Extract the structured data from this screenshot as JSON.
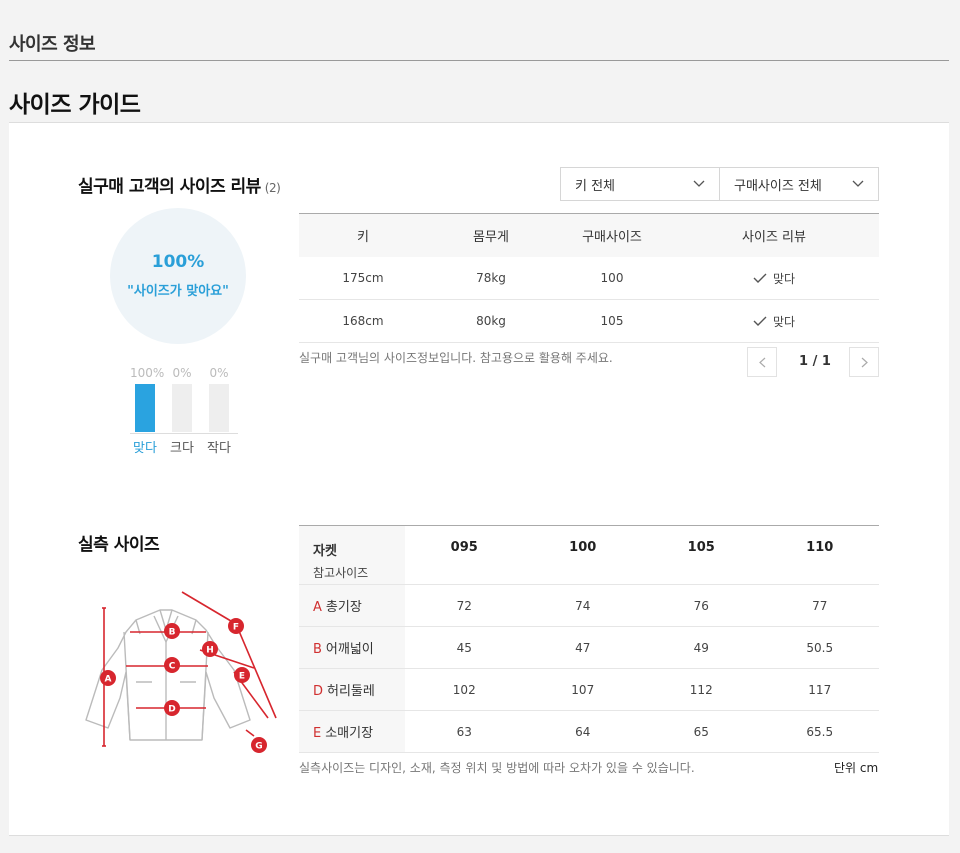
{
  "header": {
    "title": "사이즈 정보",
    "guide_title": "사이즈 가이드"
  },
  "review": {
    "title": "실구매 고객의 사이즈 리뷰",
    "count": "(2)",
    "filters": {
      "height": "키 전체",
      "size": "구매사이즈 전체"
    },
    "summary": {
      "percent": "100%",
      "text": "\"사이즈가 맞아요\""
    },
    "bars": [
      {
        "pct": "100%",
        "label": "맞다",
        "value": 1.0,
        "active": true
      },
      {
        "pct": "0%",
        "label": "크다",
        "value": 0.0,
        "active": false
      },
      {
        "pct": "0%",
        "label": "작다",
        "value": 0.0,
        "active": false
      }
    ],
    "columns": [
      "키",
      "몸무게",
      "구매사이즈",
      "사이즈 리뷰"
    ],
    "rows": [
      {
        "height": "175cm",
        "weight": "78kg",
        "size": "100",
        "review": "맞다"
      },
      {
        "height": "168cm",
        "weight": "80kg",
        "size": "105",
        "review": "맞다"
      }
    ],
    "note": "실구매 고객님의 사이즈정보입니다. 참고용으로 활용해 주세요.",
    "pagination": "1 / 1"
  },
  "measure": {
    "title": "실측 사이즈",
    "header": {
      "label": "자켓",
      "sub": "참고사이즈",
      "sizes": [
        "095",
        "100",
        "105",
        "110"
      ]
    },
    "rows": [
      {
        "code": "A",
        "name": "총기장",
        "values": [
          "72",
          "74",
          "76",
          "77"
        ]
      },
      {
        "code": "B",
        "name": "어깨넓이",
        "values": [
          "45",
          "47",
          "49",
          "50.5"
        ]
      },
      {
        "code": "D",
        "name": "허리둘레",
        "values": [
          "102",
          "107",
          "112",
          "117"
        ]
      },
      {
        "code": "E",
        "name": "소매기장",
        "values": [
          "63",
          "64",
          "65",
          "65.5"
        ]
      }
    ],
    "note": "실측사이즈는 디자인, 소재, 측정 위치 및 방법에 따라 오차가 있을 수 있습니다.",
    "unit": "단위 cm",
    "diagram_markers": [
      "A",
      "B",
      "C",
      "D",
      "E",
      "F",
      "G",
      "H"
    ]
  },
  "colors": {
    "accent": "#2a9fd8",
    "marker": "#d7262e"
  }
}
